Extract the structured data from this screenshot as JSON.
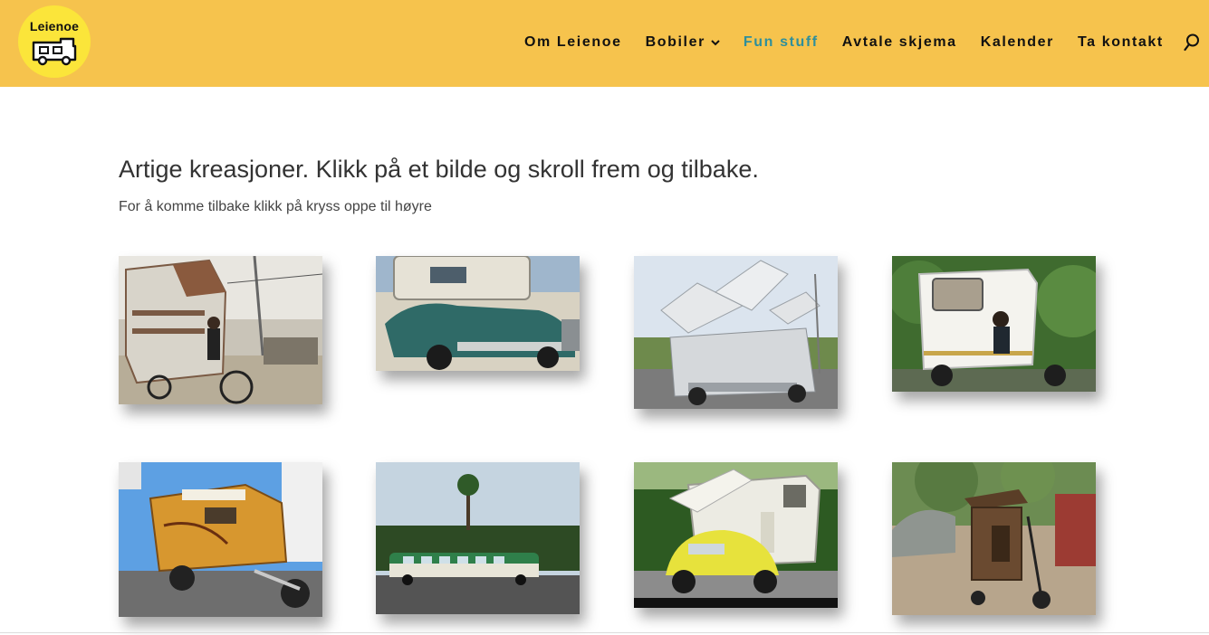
{
  "logo": {
    "text": "Leienoe"
  },
  "nav": {
    "items": [
      {
        "label": "Om Leienoe"
      },
      {
        "label": "Bobiler"
      },
      {
        "label": "Fun stuff"
      },
      {
        "label": "Avtale skjema"
      },
      {
        "label": "Kalender"
      },
      {
        "label": "Ta kontakt"
      }
    ],
    "search_icon": "search-icon"
  },
  "content": {
    "title": "Artige kreasjoner. Klikk på et bilde og skroll frem og tilbake.",
    "subtitle": "For å komme tilbake klikk på kryss oppe til høyre"
  },
  "colors": {
    "header_bg": "#f6c34d",
    "logo_bg": "#fbe53a",
    "nav_active": "#2f8f9b"
  }
}
